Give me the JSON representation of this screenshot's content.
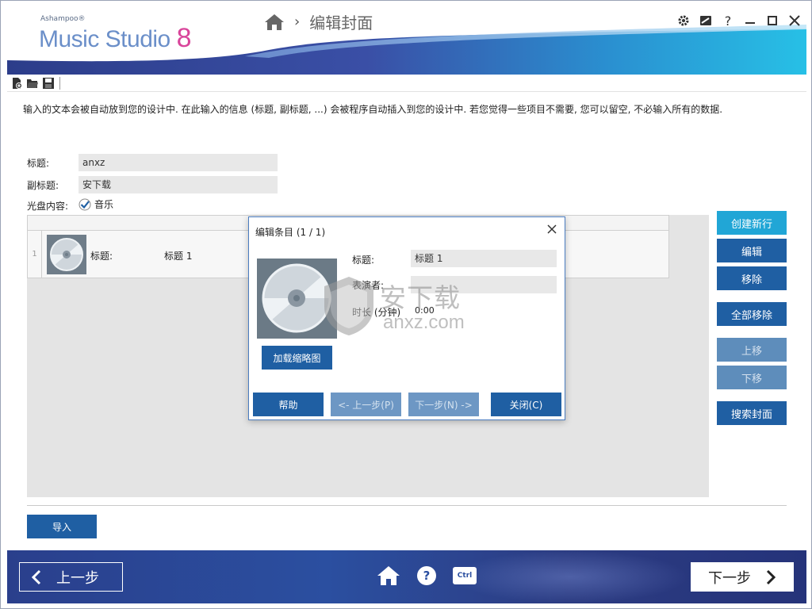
{
  "app": {
    "brand_small": "Ashampoo®",
    "brand_name": "Music Studio",
    "brand_version": "8",
    "page_title": "编辑封面"
  },
  "info_text": "输入的文本会被自动放到您的设计中. 在此输入的信息 (标题, 副标题, ...) 会被程序自动插入到您的设计中. 若您觉得一些项目不需要, 您可以留空, 不必输入所有的数据.",
  "form": {
    "title_label": "标题:",
    "title_value": "anxz",
    "subtitle_label": "副标题:",
    "subtitle_value": "安下载",
    "content_label": "光盘内容:",
    "content_option": "音乐",
    "content_checked": true
  },
  "list": {
    "rows": [
      {
        "num": "1",
        "label": "标题:",
        "value": "标题 1"
      }
    ]
  },
  "side_buttons": {
    "create": "创建新行",
    "edit": "编辑",
    "remove": "移除",
    "remove_all": "全部移除",
    "move_up": "上移",
    "move_down": "下移",
    "search_cover": "搜索封面"
  },
  "import_label": "导入",
  "dialog": {
    "title": "编辑条目 (1 / 1)",
    "load_thumb": "加载缩略图",
    "title_label": "标题:",
    "title_value": "标题 1",
    "performer_label": "表演者:",
    "performer_value": "",
    "duration_label": "时长 (分钟)",
    "duration_value": "0:00",
    "help": "帮助",
    "prev": "<- 上一步(P)",
    "next": "下一步(N) ->",
    "close": "关闭(C)"
  },
  "footer": {
    "prev_label": "上一步",
    "next_label": "下一步",
    "ctrl_label": "Ctrl"
  },
  "watermark": {
    "text_big": "安下载",
    "text_small": "anxz.com"
  },
  "colors": {
    "primary_button": "#1f5fa3",
    "accent_button": "#21a6d6",
    "footer_bg": "#2b4fa0",
    "logo_blue": "#6b8fc9",
    "logo_pink": "#d9459b"
  }
}
